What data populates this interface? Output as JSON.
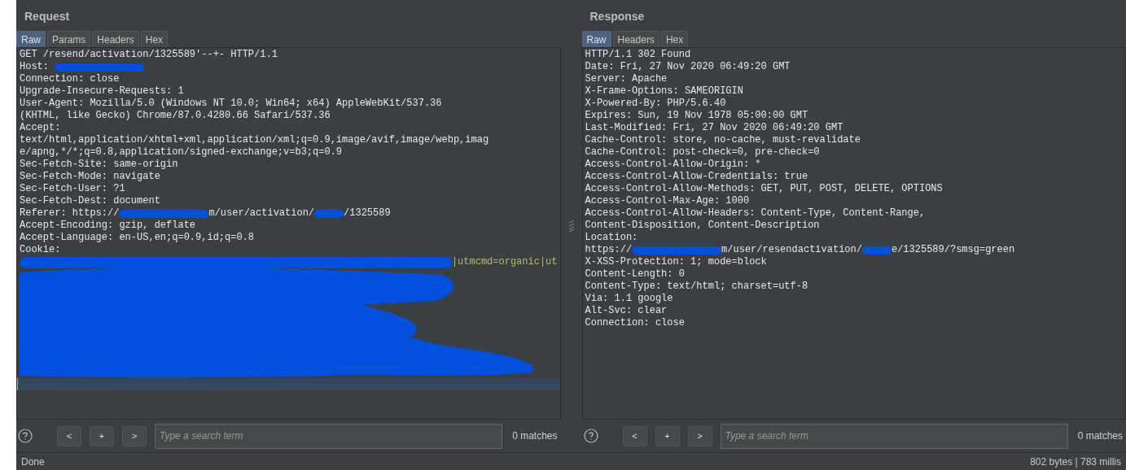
{
  "panels": [
    {
      "title": "Request",
      "tabs": [
        {
          "label": "Raw",
          "selected": true
        },
        {
          "label": "Params",
          "selected": false
        },
        {
          "label": "Headers",
          "selected": false
        },
        {
          "label": "Hex",
          "selected": false
        }
      ],
      "lines": [
        [
          {
            "kind": "text",
            "text": "GET /resend/activation/1325589'--+- HTTP/1.1"
          }
        ],
        [
          {
            "kind": "text",
            "text": "Host: "
          },
          {
            "kind": "redacted_long"
          }
        ],
        [
          {
            "kind": "text",
            "text": "Connection: close"
          }
        ],
        [
          {
            "kind": "text",
            "text": "Upgrade-Insecure-Requests: 1"
          }
        ],
        [
          {
            "kind": "text",
            "text": "User-Agent: Mozilla/5.0 (Windows NT 10.0; Win64; x64) AppleWebKit/537.36"
          }
        ],
        [
          {
            "kind": "text",
            "text": "(KHTML, like Gecko) Chrome/87.0.4280.66 Safari/537.36"
          }
        ],
        [
          {
            "kind": "text",
            "text": "Accept:"
          }
        ],
        [
          {
            "kind": "text",
            "text": "text/html,application/xhtml+xml,application/xml;q=0.9,image/avif,image/webp,imag"
          }
        ],
        [
          {
            "kind": "text",
            "text": "e/apng,*/*;q=0.8,application/signed-exchange;v=b3;q=0.9"
          }
        ],
        [
          {
            "kind": "text",
            "text": "Sec-Fetch-Site: same-origin"
          }
        ],
        [
          {
            "kind": "text",
            "text": "Sec-Fetch-Mode: navigate"
          }
        ],
        [
          {
            "kind": "text",
            "text": "Sec-Fetch-User: ?1"
          }
        ],
        [
          {
            "kind": "text",
            "text": "Sec-Fetch-Dest: document"
          }
        ],
        [
          {
            "kind": "text",
            "text": "Referer: https://"
          },
          {
            "kind": "redacted_long"
          },
          {
            "kind": "text",
            "text": "m/user/activation/"
          },
          {
            "kind": "redacted_short"
          },
          {
            "kind": "text",
            "text": "/1325589"
          }
        ],
        [
          {
            "kind": "text",
            "text": "Accept-Encoding: gzip, deflate"
          }
        ],
        [
          {
            "kind": "text",
            "text": "Accept-Language: en-US,en;q=0.9,id;q=0.8"
          }
        ],
        [
          {
            "kind": "text",
            "text": "Cookie:"
          }
        ],
        [
          {
            "kind": "redacted_wide"
          },
          {
            "kind": "param",
            "text": "|utmcmd=organic|ut"
          }
        ],
        [
          {
            "kind": "redaction_block"
          }
        ],
        [
          {
            "kind": "current_line"
          }
        ]
      ],
      "search": {
        "placeholder": "Type a search term",
        "buttons": [
          "<",
          "+",
          ">"
        ],
        "matches": "0 matches"
      }
    },
    {
      "title": "Response",
      "tabs": [
        {
          "label": "Raw",
          "selected": true
        },
        {
          "label": "Headers",
          "selected": false
        },
        {
          "label": "Hex",
          "selected": false
        }
      ],
      "lines": [
        [
          {
            "kind": "text",
            "text": "HTTP/1.1 302 Found"
          }
        ],
        [
          {
            "kind": "text",
            "text": "Date: Fri, 27 Nov 2020 06:49:20 GMT"
          }
        ],
        [
          {
            "kind": "text",
            "text": "Server: Apache"
          }
        ],
        [
          {
            "kind": "text",
            "text": "X-Frame-Options: SAMEORIGIN"
          }
        ],
        [
          {
            "kind": "text",
            "text": "X-Powered-By: PHP/5.6.40"
          }
        ],
        [
          {
            "kind": "text",
            "text": "Expires: Sun, 19 Nov 1978 05:00:00 GMT"
          }
        ],
        [
          {
            "kind": "text",
            "text": "Last-Modified: Fri, 27 Nov 2020 06:49:20 GMT"
          }
        ],
        [
          {
            "kind": "text",
            "text": "Cache-Control: store, no-cache, must-revalidate"
          }
        ],
        [
          {
            "kind": "text",
            "text": "Cache-Control: post-check=0, pre-check=0"
          }
        ],
        [
          {
            "kind": "text",
            "text": "Access-Control-Allow-Origin: *"
          }
        ],
        [
          {
            "kind": "text",
            "text": "Access-Control-Allow-Credentials: true"
          }
        ],
        [
          {
            "kind": "text",
            "text": "Access-Control-Allow-Methods: GET, PUT, POST, DELETE, OPTIONS"
          }
        ],
        [
          {
            "kind": "text",
            "text": "Access-Control-Max-Age: 1000"
          }
        ],
        [
          {
            "kind": "text",
            "text": "Access-Control-Allow-Headers: Content-Type, Content-Range,"
          }
        ],
        [
          {
            "kind": "text",
            "text": "Content-Disposition, Content-Description"
          }
        ],
        [
          {
            "kind": "text",
            "text": "Location:"
          }
        ],
        [
          {
            "kind": "text",
            "text": "https://"
          },
          {
            "kind": "redacted_long"
          },
          {
            "kind": "text",
            "text": "m/user/resendactivation/"
          },
          {
            "kind": "redacted_short"
          },
          {
            "kind": "text",
            "text": "e/1325589/?smsg=green"
          }
        ],
        [
          {
            "kind": "text",
            "text": "X-XSS-Protection: 1; mode=block"
          }
        ],
        [
          {
            "kind": "text",
            "text": "Content-Length: 0"
          }
        ],
        [
          {
            "kind": "text",
            "text": "Content-Type: text/html; charset=utf-8"
          }
        ],
        [
          {
            "kind": "text",
            "text": "Via: 1.1 google"
          }
        ],
        [
          {
            "kind": "text",
            "text": "Alt-Svc: clear"
          }
        ],
        [
          {
            "kind": "text",
            "text": "Connection: close"
          }
        ]
      ],
      "search": {
        "placeholder": "Type a search term",
        "buttons": [
          "<",
          "+",
          ">"
        ],
        "matches": "0 matches"
      }
    }
  ],
  "status_bar": {
    "left": "Done",
    "right": "802 bytes | 783 millis"
  }
}
